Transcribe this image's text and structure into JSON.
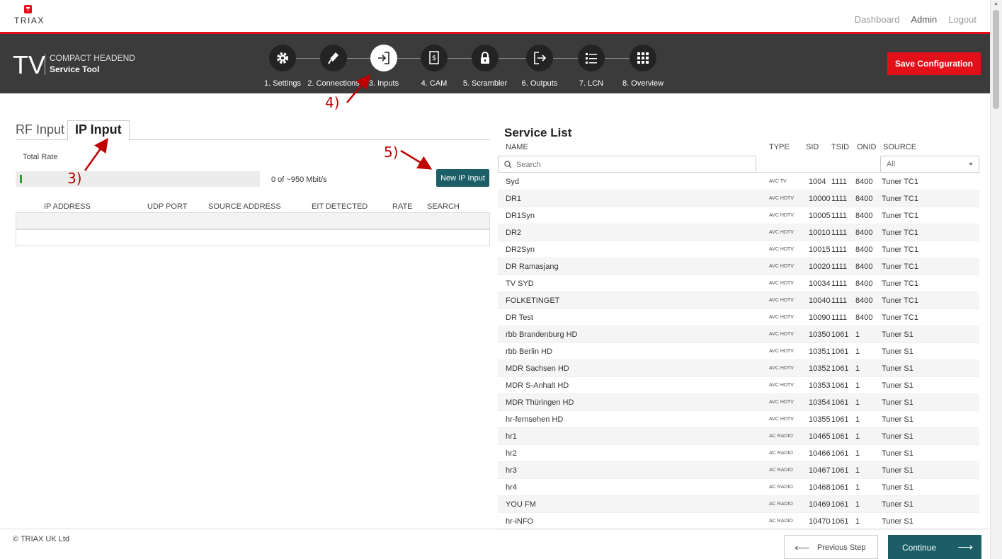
{
  "brand": {
    "logo_text": "TRIAX",
    "tv_mark": "TV",
    "product_name": "COMPACT HEADEND",
    "product_sub": "Service Tool"
  },
  "toplinks": {
    "dashboard": "Dashboard",
    "admin": "Admin",
    "logout": "Logout"
  },
  "save_button": "Save Configuration",
  "steps": [
    {
      "label": "1. Settings",
      "icon": "gear-icon"
    },
    {
      "label": "2. Connections",
      "icon": "plug-icon"
    },
    {
      "label": "3. Inputs",
      "icon": "input-arrow-icon",
      "active": true
    },
    {
      "label": "4. CAM",
      "icon": "cam-card-icon"
    },
    {
      "label": "5. Scrambler",
      "icon": "lock-icon"
    },
    {
      "label": "6. Outputs",
      "icon": "output-arrow-icon"
    },
    {
      "label": "7. LCN",
      "icon": "list-icon"
    },
    {
      "label": "8. Overview",
      "icon": "grid-icon"
    }
  ],
  "tabs": {
    "rf": "RF Input",
    "ip": "IP Input"
  },
  "total_rate": {
    "label": "Total Rate",
    "text": "0 of ~950 Mbit/s",
    "fill_fraction": 0.0
  },
  "new_ip_button": "New IP Input",
  "ip_table": {
    "headers": [
      "IP ADDRESS",
      "UDP PORT",
      "SOURCE ADDRESS",
      "EIT DETECTED",
      "RATE",
      "SEARCH"
    ]
  },
  "service_list": {
    "title": "Service List",
    "headers": {
      "name": "NAME",
      "type": "TYPE",
      "sid": "SID",
      "tsid": "TSID",
      "onid": "ONID",
      "source": "SOURCE"
    },
    "search_placeholder": "Search",
    "source_filter": "All",
    "rows": [
      {
        "name": "Syd",
        "type": "AVC TV",
        "sid": "1004",
        "tsid": "1111",
        "onid": "8400",
        "source": "Tuner TC1"
      },
      {
        "name": "DR1",
        "type": "AVC HDTV",
        "sid": "10000",
        "tsid": "1111",
        "onid": "8400",
        "source": "Tuner TC1"
      },
      {
        "name": "DR1Syn",
        "type": "AVC HDTV",
        "sid": "10005",
        "tsid": "1111",
        "onid": "8400",
        "source": "Tuner TC1"
      },
      {
        "name": "DR2",
        "type": "AVC HDTV",
        "sid": "10010",
        "tsid": "1111",
        "onid": "8400",
        "source": "Tuner TC1"
      },
      {
        "name": "DR2Syn",
        "type": "AVC HDTV",
        "sid": "10015",
        "tsid": "1111",
        "onid": "8400",
        "source": "Tuner TC1"
      },
      {
        "name": "DR Ramasjang",
        "type": "AVC HDTV",
        "sid": "10020",
        "tsid": "1111",
        "onid": "8400",
        "source": "Tuner TC1"
      },
      {
        "name": "TV SYD",
        "type": "AVC HDTV",
        "sid": "10034",
        "tsid": "1111",
        "onid": "8400",
        "source": "Tuner TC1"
      },
      {
        "name": "FOLKETINGET",
        "type": "AVC HDTV",
        "sid": "10040",
        "tsid": "1111",
        "onid": "8400",
        "source": "Tuner TC1"
      },
      {
        "name": "DR Test",
        "type": "AVC HDTV",
        "sid": "10090",
        "tsid": "1111",
        "onid": "8400",
        "source": "Tuner TC1"
      },
      {
        "name": "rbb Brandenburg HD",
        "type": "AVC HDTV",
        "sid": "10350",
        "tsid": "1061",
        "onid": "1",
        "source": "Tuner S1"
      },
      {
        "name": "rbb Berlin HD",
        "type": "AVC HDTV",
        "sid": "10351",
        "tsid": "1061",
        "onid": "1",
        "source": "Tuner S1"
      },
      {
        "name": "MDR Sachsen HD",
        "type": "AVC HDTV",
        "sid": "10352",
        "tsid": "1061",
        "onid": "1",
        "source": "Tuner S1"
      },
      {
        "name": "MDR S-Anhalt HD",
        "type": "AVC HDTV",
        "sid": "10353",
        "tsid": "1061",
        "onid": "1",
        "source": "Tuner S1"
      },
      {
        "name": "MDR Thüringen HD",
        "type": "AVC HDTV",
        "sid": "10354",
        "tsid": "1061",
        "onid": "1",
        "source": "Tuner S1"
      },
      {
        "name": "hr-fernsehen HD",
        "type": "AVC HDTV",
        "sid": "10355",
        "tsid": "1061",
        "onid": "1",
        "source": "Tuner S1"
      },
      {
        "name": "hr1",
        "type": "AC RADIO",
        "sid": "10465",
        "tsid": "1061",
        "onid": "1",
        "source": "Tuner S1"
      },
      {
        "name": "hr2",
        "type": "AC RADIO",
        "sid": "10466",
        "tsid": "1061",
        "onid": "1",
        "source": "Tuner S1"
      },
      {
        "name": "hr3",
        "type": "AC RADIO",
        "sid": "10467",
        "tsid": "1061",
        "onid": "1",
        "source": "Tuner S1"
      },
      {
        "name": "hr4",
        "type": "AC RADIO",
        "sid": "10468",
        "tsid": "1061",
        "onid": "1",
        "source": "Tuner S1"
      },
      {
        "name": "YOU FM",
        "type": "AC RADIO",
        "sid": "10469",
        "tsid": "1061",
        "onid": "1",
        "source": "Tuner S1"
      },
      {
        "name": "hr-iNFO",
        "type": "AC RADIO",
        "sid": "10470",
        "tsid": "1061",
        "onid": "1",
        "source": "Tuner S1"
      }
    ]
  },
  "footer": {
    "copyright": "© TRIAX UK Ltd",
    "previous": "Previous Step",
    "continue": "Continue"
  },
  "annotations": {
    "a3": "3)",
    "a4": "4)",
    "a5": "5)"
  },
  "colors": {
    "accent_red": "#e3101a",
    "teal": "#1b5e67",
    "header_bg": "#3b3b3b",
    "annotation": "#c00000"
  }
}
